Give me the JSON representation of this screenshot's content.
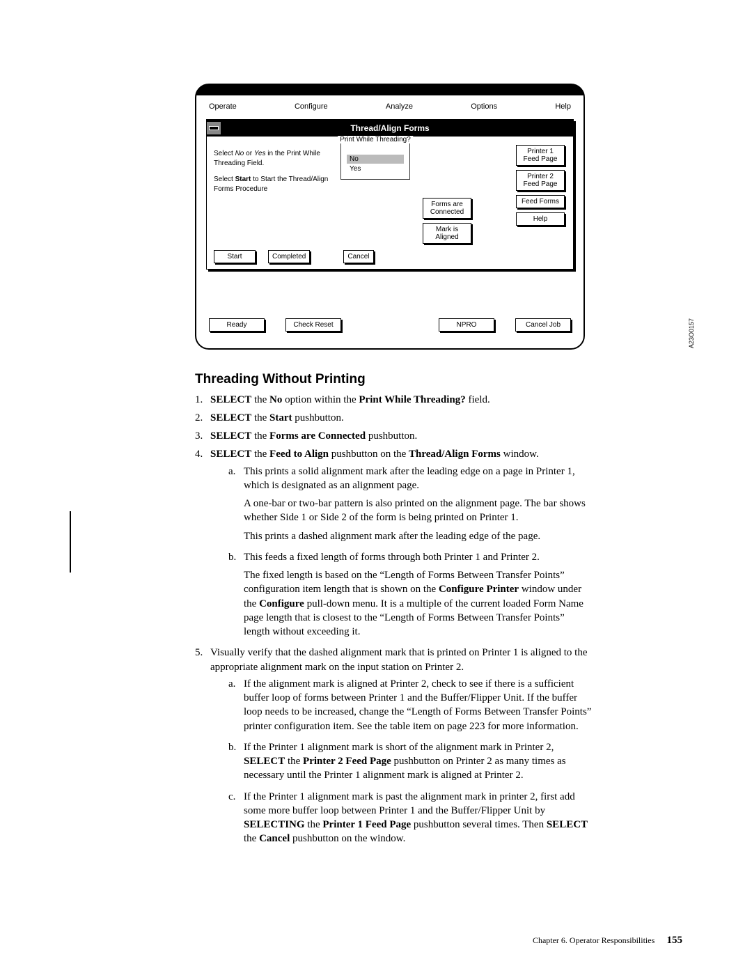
{
  "window": {
    "menu": {
      "operate": "Operate",
      "configure": "Configure",
      "analyze": "Analyze",
      "options": "Options",
      "help": "Help"
    },
    "panel_title": "Thread/Align Forms",
    "instr1a": "Select ",
    "instr1b": " or ",
    "instr1c": " in the Print While Threading Field.",
    "no_it": "No",
    "yes_it": "Yes",
    "instr2a": "Select ",
    "instr2b": " to Start the Thread/Align Forms Procedure",
    "start_bold": "Start",
    "pwt_label": "Print While Threading?",
    "opt_no": "No",
    "opt_yes": "Yes",
    "btn_p1": "Printer 1 Feed Page",
    "btn_p2": "Printer 2 Feed Page",
    "btn_feedforms": "Feed Forms",
    "btn_help": "Help",
    "btn_formsconn": "Forms are Connected",
    "btn_markaligned": "Mark is Aligned",
    "btn_start": "Start",
    "btn_completed": "Completed",
    "btn_cancel": "Cancel",
    "btn_ready": "Ready",
    "btn_checkreset": "Check Reset",
    "btn_npro": "NPRO",
    "btn_canceljob": "Cancel Job"
  },
  "figcode": "A23O0157",
  "heading": "Threading Without Printing",
  "steps": {
    "s1": {
      "num": "1.",
      "t": "SELECT the No option within the Print While Threading? field."
    },
    "s2": {
      "num": "2.",
      "t": "SELECT the Start pushbutton."
    },
    "s3": {
      "num": "3.",
      "t": "SELECT the Forms are Connected pushbutton."
    },
    "s4": {
      "num": "4.",
      "t": "SELECT the Feed to Align pushbutton on the Thread/Align Forms window.",
      "a": {
        "num": "a.",
        "p1": "This prints a solid alignment mark after the leading edge on a page in Printer 1, which is designated as an alignment page.",
        "p2": "A one-bar or two-bar pattern is also printed on the alignment page. The bar shows whether Side 1 or Side 2 of the form is being printed on Printer 1.",
        "p3": "This prints a dashed alignment mark after the leading edge of the page."
      },
      "b": {
        "num": "b.",
        "p1": "This feeds a fixed length of forms through both Printer 1 and Printer 2.",
        "p2": "The fixed length is based on the “Length of Forms Between Transfer Points” configuration item length that is shown on the Configure Printer window under the Configure pull-down menu. It is a multiple of the current loaded Form Name page length that is closest to the “Length of Forms Between Transfer Points” length without exceeding it."
      }
    },
    "s5": {
      "num": "5.",
      "t": "Visually verify that the dashed alignment mark that is printed on Printer 1 is aligned to the appropriate alignment mark on the input station on Printer 2.",
      "a": {
        "num": "a.",
        "p1": "If the alignment mark is aligned at Printer 2, check to see if there is a sufficient buffer loop of forms between Printer 1 and the Buffer/Flipper Unit. If the buffer loop needs to be increased, change the “Length of Forms Between Transfer Points” printer configuration item. See the table item on page 223 for more information."
      },
      "b": {
        "num": "b.",
        "p1": "If the Printer 1 alignment mark is short of the alignment mark in Printer 2, SELECT the Printer 2 Feed Page pushbutton on Printer 2 as many times as necessary until the Printer 1 alignment mark is aligned at Printer 2."
      },
      "c": {
        "num": "c.",
        "p1": "If the Printer 1 alignment mark is past the alignment mark in printer 2, first add some more buffer loop between Printer 1 and the Buffer/Flipper Unit by SELECTING the Printer 1 Feed Page pushbutton several times. Then SELECT the Cancel pushbutton on the window."
      }
    }
  },
  "footer": {
    "chapter": "Chapter 6. Operator Responsibilities",
    "page": "155"
  }
}
